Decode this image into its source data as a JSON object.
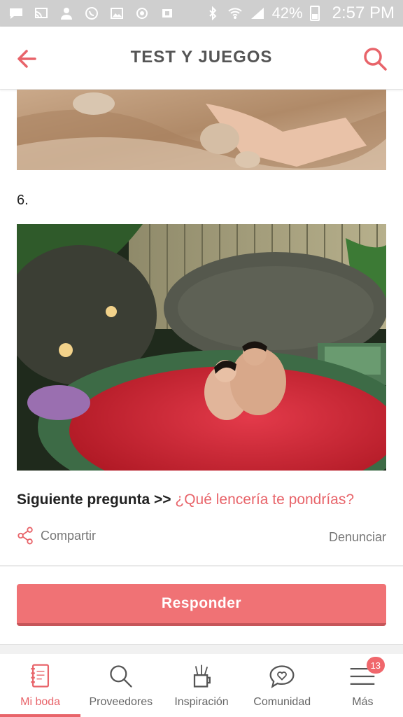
{
  "status_bar": {
    "battery": "42%",
    "time": "2:57 PM",
    "icons": [
      "chat-icon",
      "cast-icon",
      "person-icon",
      "whatsapp-icon",
      "image-icon",
      "sync-icon",
      "office-icon",
      "bluetooth-icon",
      "wifi-icon",
      "signal-icon",
      "battery-icon"
    ]
  },
  "app_bar": {
    "title": "TEST Y JUEGOS",
    "back_icon": "arrow-left-icon",
    "search_icon": "search-icon"
  },
  "content": {
    "item_number": "6.",
    "next_question_prefix": "Siguiente pregunta >>",
    "next_question_link": "¿Qué lencería te pondrías?",
    "share_label": "Compartir",
    "report_label": "Denunciar",
    "respond_button": "Responder"
  },
  "bottom_nav": {
    "items": [
      {
        "label": "Mi boda",
        "icon": "notebook-icon",
        "active": true
      },
      {
        "label": "Proveedores",
        "icon": "search-icon"
      },
      {
        "label": "Inspiración",
        "icon": "pencil-cup-icon"
      },
      {
        "label": "Comunidad",
        "icon": "chat-heart-icon"
      },
      {
        "label": "Más",
        "icon": "menu-icon",
        "badge": "13"
      }
    ]
  },
  "colors": {
    "accent": "#e8646a",
    "button": "#f07275",
    "status_bar": "#cfcfcf"
  }
}
